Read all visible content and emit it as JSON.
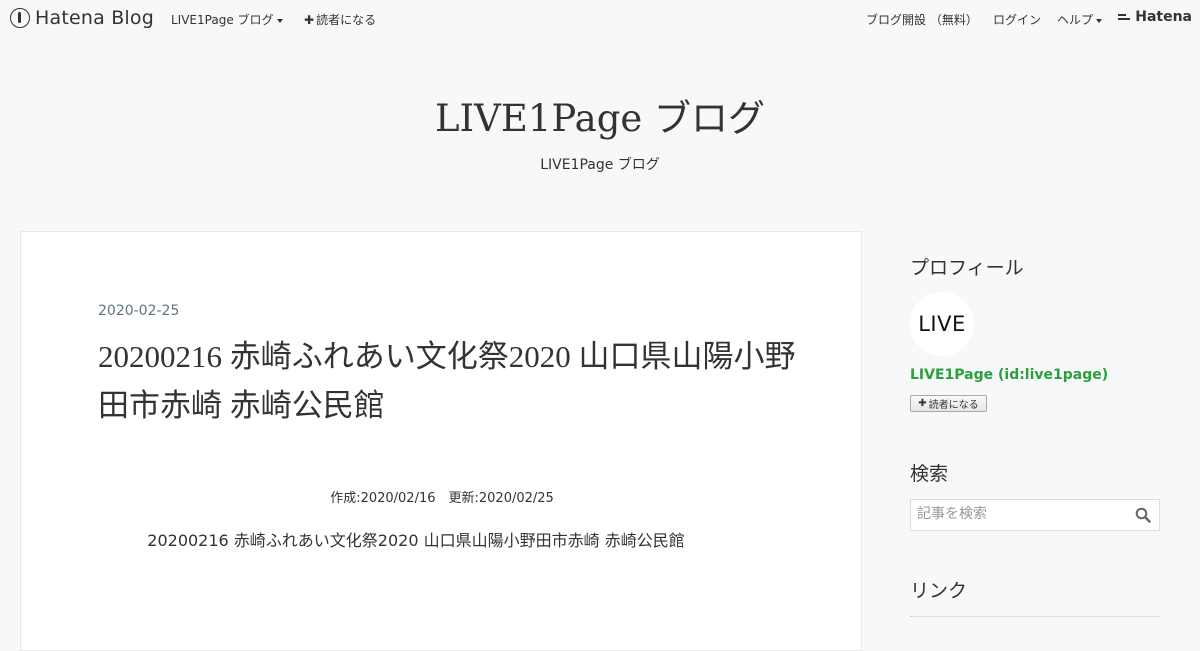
{
  "global_header": {
    "brand": "Hatena Blog",
    "blog_menu": "LIVE1Page ブログ",
    "subscribe": "読者になる",
    "open_blog": "ブログ開設 （無料）",
    "login": "ログイン",
    "help": "ヘルプ",
    "hatena": "Hatena"
  },
  "blog": {
    "title": "LIVE1Page ブログ",
    "description": "LIVE1Page ブログ"
  },
  "entry": {
    "date": "2020-02-25",
    "title": "20200216 赤崎ふれあい文化祭2020 山口県山陽小野田市赤崎 赤崎公民館",
    "meta": "作成:2020/02/16　更新:2020/02/25",
    "body": "20200216 赤崎ふれあい文化祭2020 山口県山陽小野田市赤崎 赤崎公民館"
  },
  "sidebar": {
    "profile_heading": "プロフィール",
    "avatar_text": "LIVE",
    "profile_name": "LIVE1Page (id:live1page)",
    "follow_button": "読者になる",
    "search_heading": "検索",
    "search_placeholder": "記事を検索",
    "links_heading": "リンク"
  },
  "colors": {
    "background": "#f7f8fa",
    "accent_green": "#2c9e3b",
    "date_color": "#5a7582"
  },
  "icons": [
    "hatena-blog-logo-icon",
    "caret-down-icon",
    "plus-icon",
    "hatena-logo-icon",
    "search-icon"
  ]
}
